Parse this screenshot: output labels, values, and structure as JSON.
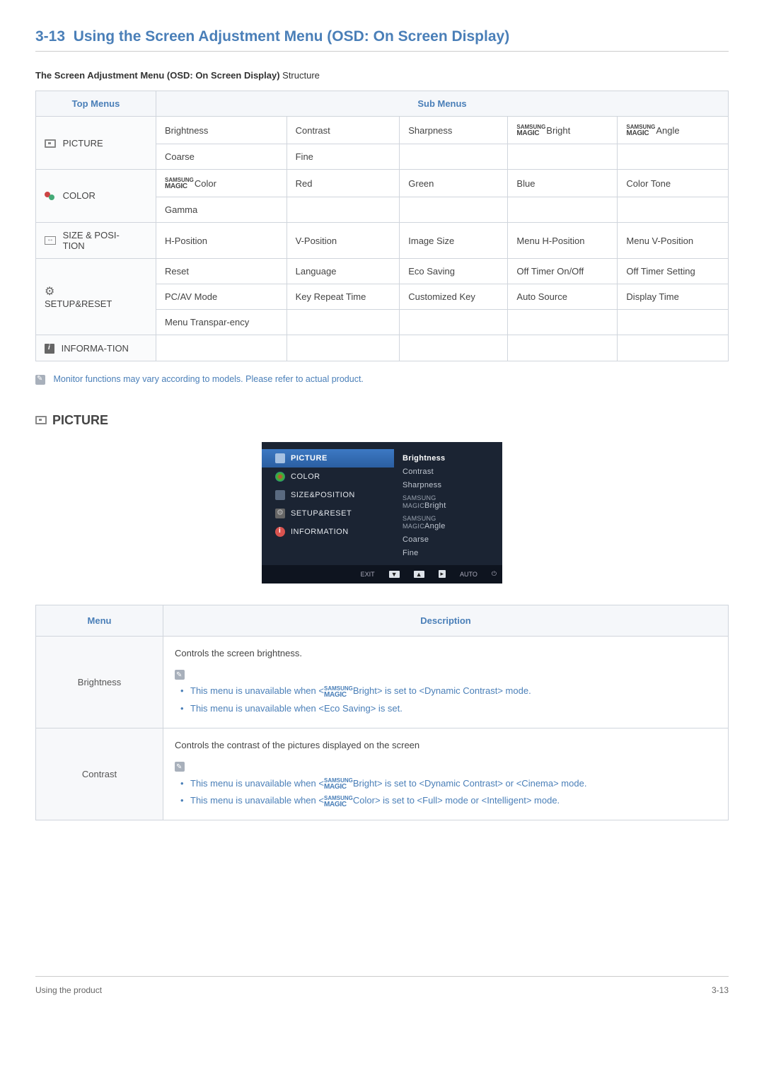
{
  "section": {
    "number": "3-13",
    "title": "Using the Screen Adjustment Menu (OSD: On Screen Display)"
  },
  "sub_heading_bold": "The Screen Adjustment Menu (OSD: On Screen Display)",
  "sub_heading_norm": " Structure",
  "table1": {
    "head_top": "Top Menus",
    "head_sub": "Sub Menus",
    "rows": {
      "picture": {
        "label": "PICTURE",
        "r1": {
          "c1": "Brightness",
          "c2": "Contrast",
          "c3": "Sharpness",
          "c4_suffix": "Bright",
          "c5_suffix": "Angle"
        },
        "r2": {
          "c1": "Coarse",
          "c2": "Fine",
          "c3": "",
          "c4": "",
          "c5": ""
        }
      },
      "color": {
        "label": "COLOR",
        "r1": {
          "c1_suffix": "Color",
          "c2": "Red",
          "c3": "Green",
          "c4": "Blue",
          "c5": "Color Tone"
        },
        "r2": {
          "c1": "Gamma",
          "c2": "",
          "c3": "",
          "c4": "",
          "c5": ""
        }
      },
      "size": {
        "label": "SIZE & POSI-TION",
        "r1": {
          "c1": "H-Position",
          "c2": "V-Position",
          "c3": "Image Size",
          "c4": "Menu H-Position",
          "c5": "Menu V-Position"
        }
      },
      "setup": {
        "label": "SETUP&RESET",
        "r1": {
          "c1": "Reset",
          "c2": "Language",
          "c3": "Eco Saving",
          "c4": "Off Timer On/Off",
          "c5": "Off Timer Setting"
        },
        "r2": {
          "c1": "PC/AV Mode",
          "c2": "Key Repeat Time",
          "c3": "Customized Key",
          "c4": "Auto Source",
          "c5": "Display Time"
        },
        "r3": {
          "c1": "Menu Transpar-ency",
          "c2": "",
          "c3": "",
          "c4": "",
          "c5": ""
        }
      },
      "info": {
        "label": "INFORMA-TION",
        "r1": {
          "c1": "",
          "c2": "",
          "c3": "",
          "c4": "",
          "c5": ""
        }
      }
    }
  },
  "magic": {
    "sam": "SAMSUNG",
    "mag": "MAGIC"
  },
  "note1": "Monitor functions may vary according to models. Please refer to actual product.",
  "picture_heading": "PICTURE",
  "osd": {
    "left": {
      "picture": "PICTURE",
      "color": "COLOR",
      "size": "SIZE&POSITION",
      "setup": "SETUP&RESET",
      "info": "INFORMATION"
    },
    "right": {
      "brightness": "Brightness",
      "contrast": "Contrast",
      "sharpness": "Sharpness",
      "mbright": "Bright",
      "mangle": "Angle",
      "coarse": "Coarse",
      "fine": "Fine"
    },
    "bar": {
      "exit": "EXIT",
      "auto": "AUTO"
    }
  },
  "table2": {
    "head_menu": "Menu",
    "head_desc": "Description",
    "brightness": {
      "label": "Brightness",
      "lead": "Controls the screen brightness.",
      "b1a": "This menu is unavailable when <",
      "b1b": "Bright> is set to <Dynamic Contrast> mode.",
      "b2": "This menu is unavailable when <Eco Saving> is set."
    },
    "contrast": {
      "label": "Contrast",
      "lead": "Controls the contrast of the pictures displayed on the screen",
      "b1a": "This menu is unavailable when <",
      "b1b": "Bright> is set to <Dynamic Contrast> or <Cinema> mode.",
      "b2a": "This menu is unavailable when <",
      "b2b": "Color> is set to <Full> mode or <Intelligent> mode."
    }
  },
  "footer": {
    "left": "Using the product",
    "right": "3-13"
  }
}
